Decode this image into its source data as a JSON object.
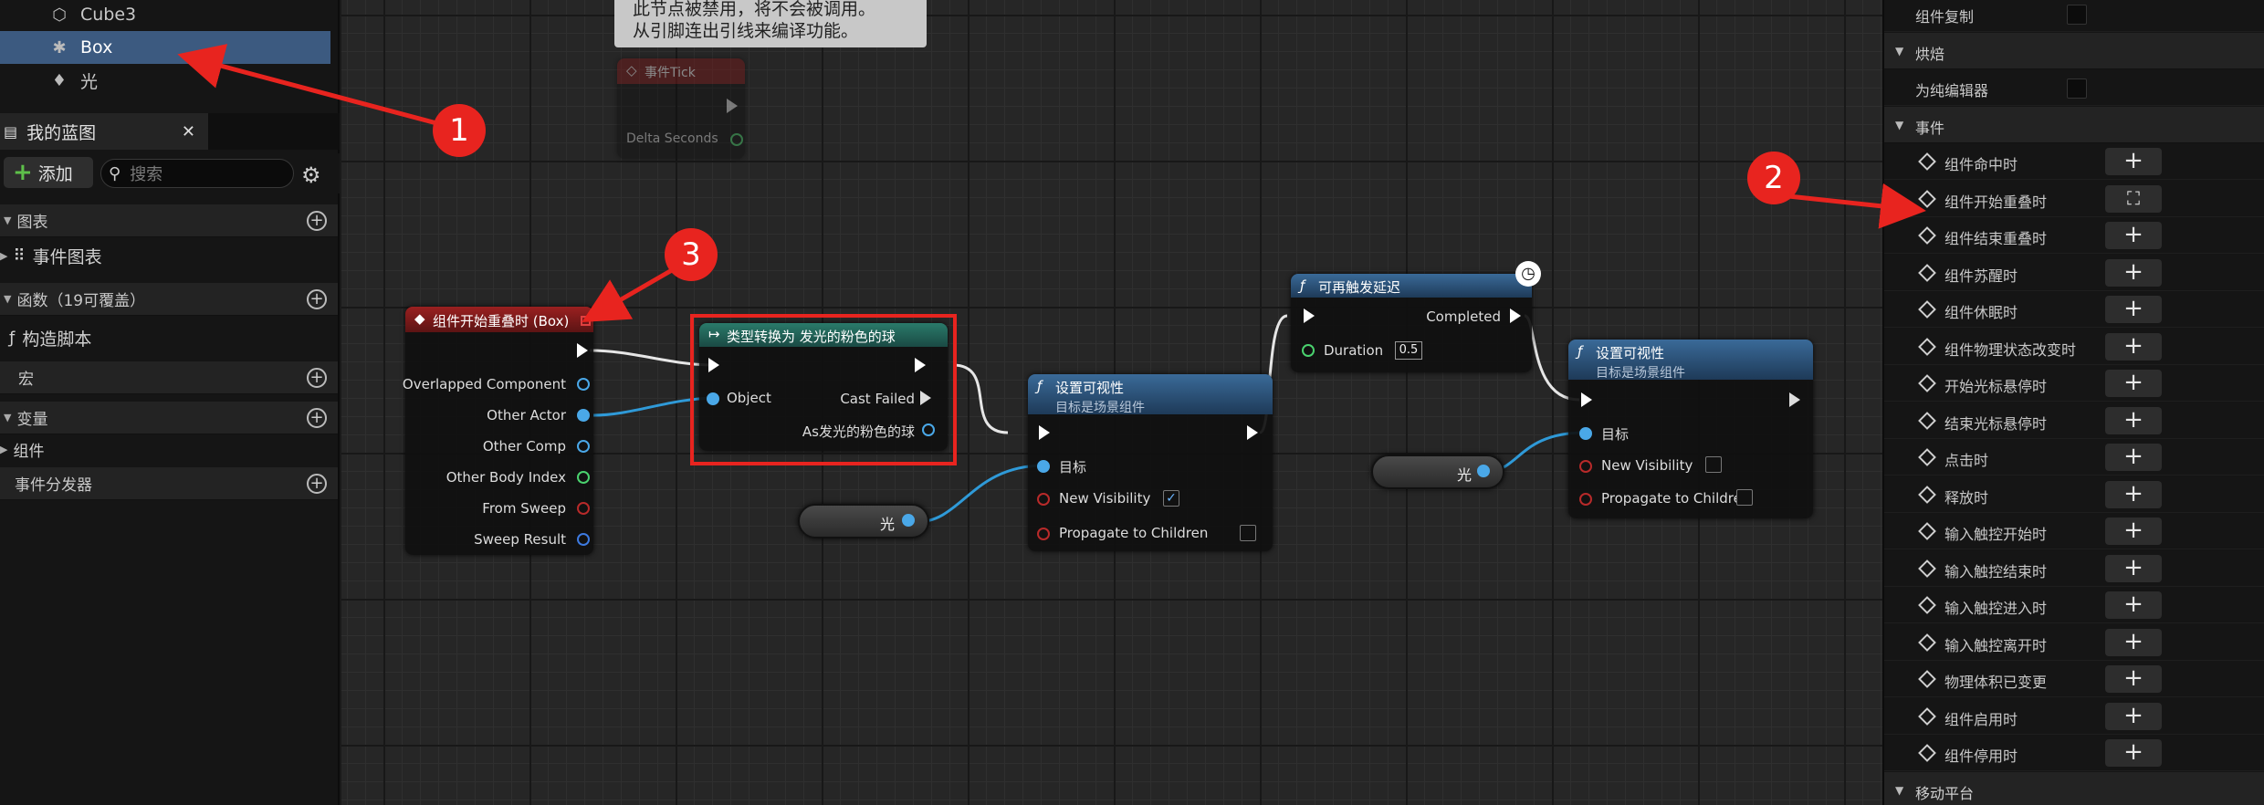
{
  "outliner": {
    "items": [
      {
        "label": "Cube3",
        "icon": "cube-icon"
      },
      {
        "label": "Box",
        "icon": "box-collision-icon",
        "selected": true
      },
      {
        "label": "光",
        "icon": "light-icon"
      }
    ]
  },
  "blueprint_panel": {
    "tab_label": "我的蓝图",
    "add_label": "添加",
    "search_placeholder": "搜索",
    "sections": {
      "graphs": "图表",
      "event_graph": "事件图表",
      "functions": "函数（19可覆盖）",
      "construction_script": "构造脚本",
      "macros": "宏",
      "variables": "变量",
      "components": "组件",
      "event_dispatchers": "事件分发器"
    }
  },
  "graph": {
    "comment_note": {
      "line1": "此节点被禁用，将不会被调用。",
      "line2": "从引脚连出引线来编译功能。"
    },
    "event_tick": {
      "title": "事件Tick",
      "pin_delta": "Delta Seconds"
    },
    "overlap_event": {
      "title": "组件开始重叠时 (Box)",
      "pins": [
        "Overlapped Component",
        "Other Actor",
        "Other Comp",
        "Other Body Index",
        "From Sweep",
        "Sweep Result"
      ]
    },
    "cast_node": {
      "title": "类型转换为 发光的粉色的球",
      "pin_object": "Object",
      "pin_cast_failed": "Cast Failed",
      "pin_as": "As发光的粉色的球"
    },
    "set_vis_1": {
      "title": "设置可视性",
      "subtitle": "目标是场景组件",
      "pin_target": "目标",
      "pin_vis": "New Visibility",
      "pin_prop": "Propagate to Children",
      "vis_checked": "✓"
    },
    "light_var_1": {
      "label": "光"
    },
    "retrigger_delay": {
      "title": "可再触发延迟",
      "pin_completed": "Completed",
      "pin_duration": "Duration",
      "duration_value": "0.5"
    },
    "set_vis_2": {
      "title": "设置可视性",
      "subtitle": "目标是场景组件",
      "pin_target": "目标",
      "pin_vis": "New Visibility",
      "pin_prop": "Propagate to Children"
    },
    "light_var_2": {
      "label": "光"
    }
  },
  "markers": {
    "m1": "1",
    "m2": "2",
    "m3": "3"
  },
  "details": {
    "rows": [
      {
        "type": "prop",
        "label": "组件复制"
      },
      {
        "type": "cat",
        "label": "烘焙"
      },
      {
        "type": "prop",
        "label": "为纯编辑器"
      },
      {
        "type": "cat",
        "label": "事件"
      },
      {
        "type": "event",
        "label": "组件命中时"
      },
      {
        "type": "event",
        "label": "组件开始重叠时",
        "focus": true
      },
      {
        "type": "event",
        "label": "组件结束重叠时"
      },
      {
        "type": "event",
        "label": "组件苏醒时"
      },
      {
        "type": "event",
        "label": "组件休眠时"
      },
      {
        "type": "event",
        "label": "组件物理状态改变时"
      },
      {
        "type": "event",
        "label": "开始光标悬停时"
      },
      {
        "type": "event",
        "label": "结束光标悬停时"
      },
      {
        "type": "event",
        "label": "点击时"
      },
      {
        "type": "event",
        "label": "释放时"
      },
      {
        "type": "event",
        "label": "输入触控开始时"
      },
      {
        "type": "event",
        "label": "输入触控结束时"
      },
      {
        "type": "event",
        "label": "输入触控进入时"
      },
      {
        "type": "event",
        "label": "输入触控离开时"
      },
      {
        "type": "event",
        "label": "物理体积已变更"
      },
      {
        "type": "event",
        "label": "组件启用时"
      },
      {
        "type": "event",
        "label": "组件停用时"
      },
      {
        "type": "cat",
        "label": "移动平台"
      }
    ],
    "add_glyph": "+",
    "focus_glyph": "⛶"
  },
  "colors": {
    "accent_red": "#e8241f",
    "selection": "#3c5a80",
    "event_head": "#8a1a1a",
    "func_head": "#2f5a82",
    "cast_head": "#1f5c54"
  }
}
